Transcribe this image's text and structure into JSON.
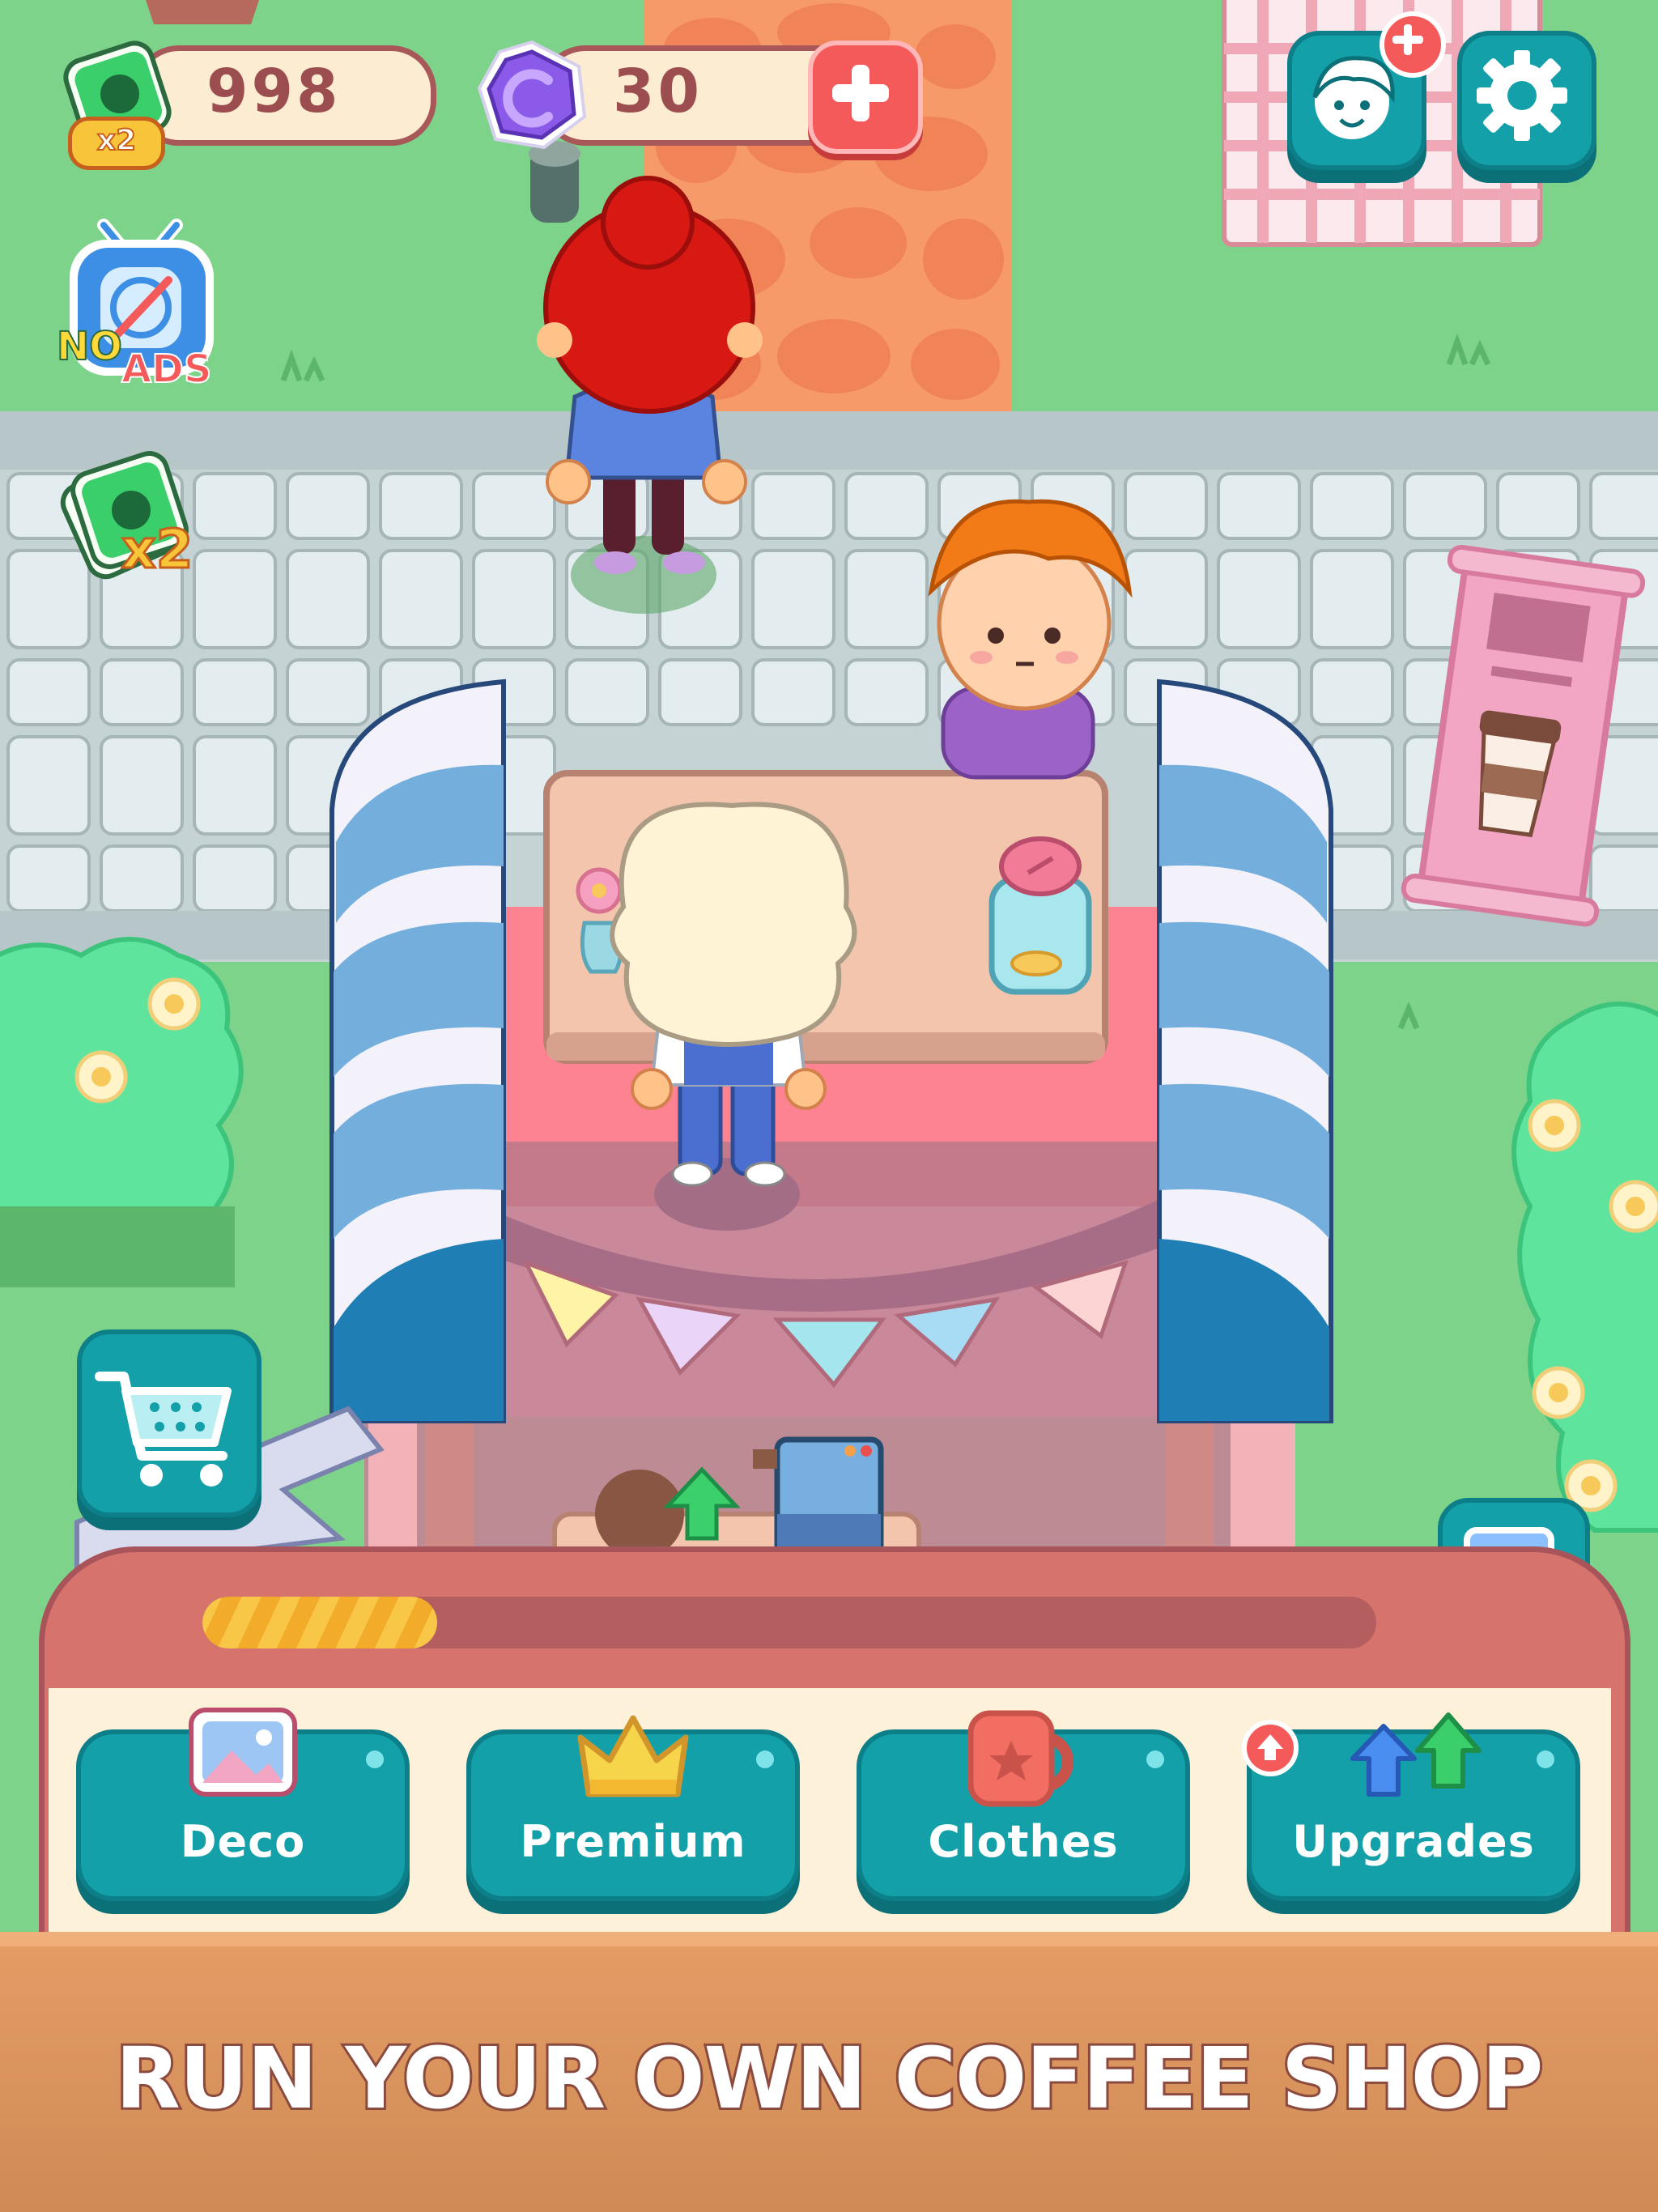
{
  "hud": {
    "cash_amount": "998",
    "cash_multiplier": "x2",
    "gem_amount": "30"
  },
  "side_buttons": {
    "no_ads_no": "NO",
    "no_ads_ads": "ADS",
    "cash_boost_multiplier": "x2"
  },
  "progress": {
    "fill_fraction": 0.2
  },
  "menu": {
    "deco_label": "Deco",
    "premium_label": "Premium",
    "clothes_label": "Clothes",
    "upgrades_label": "Upgrades"
  },
  "banner": {
    "text": "RUN YOUR OWN COFFEE SHOP"
  },
  "colors": {
    "grass": "#7dd38a",
    "teal": "#13a0a9",
    "banner": "#d9935d",
    "panel": "#d5736c"
  }
}
